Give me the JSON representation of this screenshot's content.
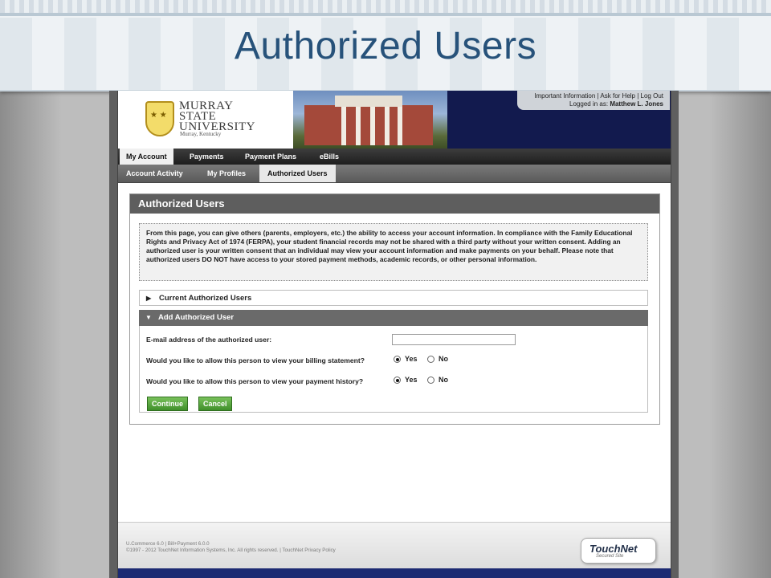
{
  "slide": {
    "title": "Authorized Users"
  },
  "header": {
    "university_line1": "MURRAY",
    "university_line2": "STATE",
    "university_line3": "UNIVERSITY",
    "university_sub": "Murray, Kentucky",
    "util_links": [
      "Important Information",
      "Ask for Help",
      "Log Out"
    ],
    "logged_in_prefix": "Logged in as:",
    "user_name": "Matthew L. Jones"
  },
  "nav_primary": [
    {
      "label": "My Account",
      "active": true
    },
    {
      "label": "Payments"
    },
    {
      "label": "Payment Plans"
    },
    {
      "label": "eBills"
    }
  ],
  "nav_secondary": [
    {
      "label": "Account Activity"
    },
    {
      "label": "My Profiles"
    },
    {
      "label": "Authorized Users",
      "active": true
    }
  ],
  "panel": {
    "title": "Authorized Users",
    "notice": "From this page, you can give others (parents, employers, etc.) the ability to access your account information. In compliance with the Family Educational Rights and Privacy Act of 1974 (FERPA), your student financial records may not be shared with a third party without your written consent. Adding an authorized user is your written consent that an individual may view your account information and make payments on your behalf. Please note that authorized users DO NOT have access to your stored payment methods, academic records, or other personal information.",
    "section_current": "Current Authorized Users",
    "section_add": "Add Authorized User",
    "email_label": "E-mail address of the authorized user:",
    "email_value": "",
    "billing_question": "Would you like to allow this person to view your billing statement?",
    "history_question": "Would you like to allow this person to view your payment history?",
    "yes": "Yes",
    "no": "No",
    "billing_selected": "Yes",
    "history_selected": "Yes",
    "continue_label": "Continue",
    "cancel_label": "Cancel"
  },
  "footer": {
    "version": "U.Commerce 6.0 | Bill+Payment 6.0.0",
    "copyright": "©1997 - 2012 TouchNet Information Systems, Inc. All rights reserved. | TouchNet Privacy Policy",
    "brand": "TouchNet",
    "brand_sub": "Secured Site"
  },
  "colors": {
    "title": "#27527a",
    "banner": "#121a4e",
    "button": "#4e9e36"
  }
}
